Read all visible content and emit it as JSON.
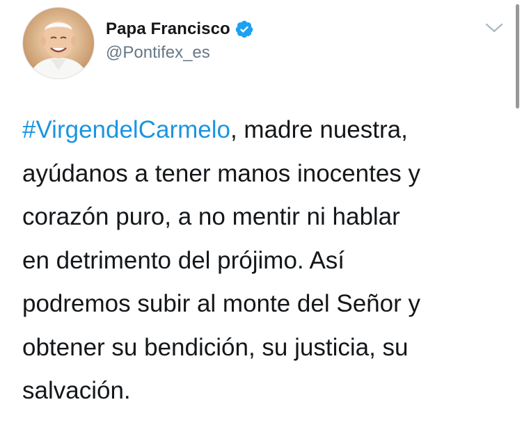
{
  "tweet": {
    "author": {
      "display_name": "Papa Francisco",
      "handle": "@Pontifex_es",
      "verified": true,
      "avatar_icon": "pope-portrait-avatar"
    },
    "menu_icon": "chevron-down-icon",
    "hashtag": "#VirgendelCarmelo",
    "lines": [
      ", madre nuestra,",
      "ayúdanos a tener manos inocentes y",
      "corazón puro, a no mentir ni hablar",
      "en detrimento del prójimo. Así",
      "podremos subir al monte del Señor y",
      "obtener su bendición, su justicia, su",
      "salvación."
    ]
  },
  "colors": {
    "hashtag": "#1b95e0",
    "verified_badge": "#1da1f2",
    "text": "#14171a",
    "handle": "#657786"
  }
}
